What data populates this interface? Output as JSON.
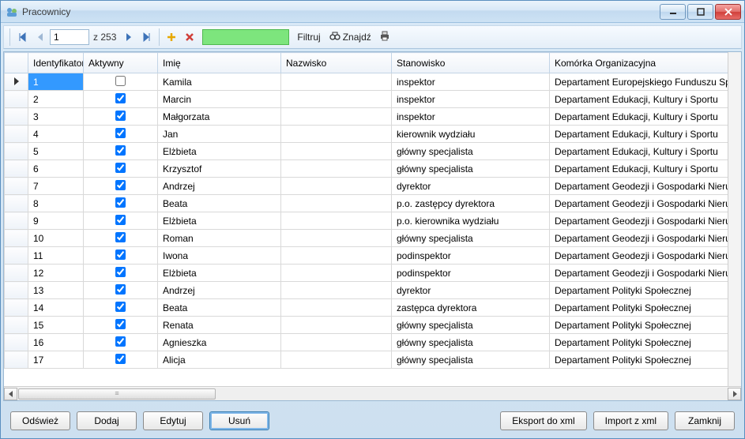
{
  "window": {
    "title": "Pracownicy"
  },
  "navigator": {
    "current": "1",
    "total_prefix": "z",
    "total": "253"
  },
  "toolbar": {
    "filter_label": "Filtruj",
    "find_label": "Znajdź"
  },
  "columns": {
    "id": "Identyfikator",
    "active": "Aktywny",
    "first": "Imię",
    "last": "Nazwisko",
    "position": "Stanowisko",
    "unit": "Komórka Organizacyjna"
  },
  "rows": [
    {
      "id": "1",
      "active": false,
      "first": "Kamila",
      "last": "",
      "position": "inspektor",
      "unit": "Departament Europejskiego Funduszu Sp"
    },
    {
      "id": "2",
      "active": true,
      "first": "Marcin",
      "last": "",
      "position": "inspektor",
      "unit": "Departament Edukacji, Kultury i Sportu"
    },
    {
      "id": "3",
      "active": true,
      "first": "Małgorzata",
      "last": "",
      "position": "inspektor",
      "unit": "Departament Edukacji, Kultury i Sportu"
    },
    {
      "id": "4",
      "active": true,
      "first": "Jan",
      "last": "",
      "position": "kierownik wydziału",
      "unit": "Departament Edukacji, Kultury i Sportu"
    },
    {
      "id": "5",
      "active": true,
      "first": "Elżbieta",
      "last": "",
      "position": "główny specjalista",
      "unit": "Departament Edukacji, Kultury i Sportu"
    },
    {
      "id": "6",
      "active": true,
      "first": "Krzysztof",
      "last": "",
      "position": "główny specjalista",
      "unit": "Departament Edukacji, Kultury i Sportu"
    },
    {
      "id": "7",
      "active": true,
      "first": "Andrzej",
      "last": "",
      "position": "dyrektor",
      "unit": "Departament Geodezji i Gospodarki Nieru"
    },
    {
      "id": "8",
      "active": true,
      "first": "Beata",
      "last": "",
      "position": "p.o. zastępcy dyrektora",
      "unit": "Departament Geodezji i Gospodarki Nieru"
    },
    {
      "id": "9",
      "active": true,
      "first": "Elżbieta",
      "last": "",
      "position": "p.o. kierownika wydziału",
      "unit": "Departament Geodezji i Gospodarki Nieru"
    },
    {
      "id": "10",
      "active": true,
      "first": "Roman",
      "last": "",
      "position": "główny specjalista",
      "unit": "Departament Geodezji i Gospodarki Nieru"
    },
    {
      "id": "11",
      "active": true,
      "first": "Iwona",
      "last": "",
      "position": "podinspektor",
      "unit": "Departament Geodezji i Gospodarki Nieru"
    },
    {
      "id": "12",
      "active": true,
      "first": "Elżbieta",
      "last": "",
      "position": "podinspektor",
      "unit": "Departament Geodezji i Gospodarki Nieru"
    },
    {
      "id": "13",
      "active": true,
      "first": "Andrzej",
      "last": "",
      "position": "dyrektor",
      "unit": "Departament Polityki Społecznej"
    },
    {
      "id": "14",
      "active": true,
      "first": "Beata",
      "last": "",
      "position": "zastępca dyrektora",
      "unit": "Departament Polityki Społecznej"
    },
    {
      "id": "15",
      "active": true,
      "first": "Renata",
      "last": "",
      "position": "główny specjalista",
      "unit": "Departament Polityki Społecznej"
    },
    {
      "id": "16",
      "active": true,
      "first": "Agnieszka",
      "last": "",
      "position": "główny specjalista",
      "unit": "Departament Polityki Społecznej"
    },
    {
      "id": "17",
      "active": true,
      "first": "Alicja",
      "last": "",
      "position": "główny specjalista",
      "unit": "Departament Polityki Społecznej"
    }
  ],
  "footer": {
    "refresh": "Odśwież",
    "add": "Dodaj",
    "edit": "Edytuj",
    "delete": "Usuń",
    "export": "Eksport do xml",
    "import": "Import z xml",
    "close": "Zamknij"
  }
}
